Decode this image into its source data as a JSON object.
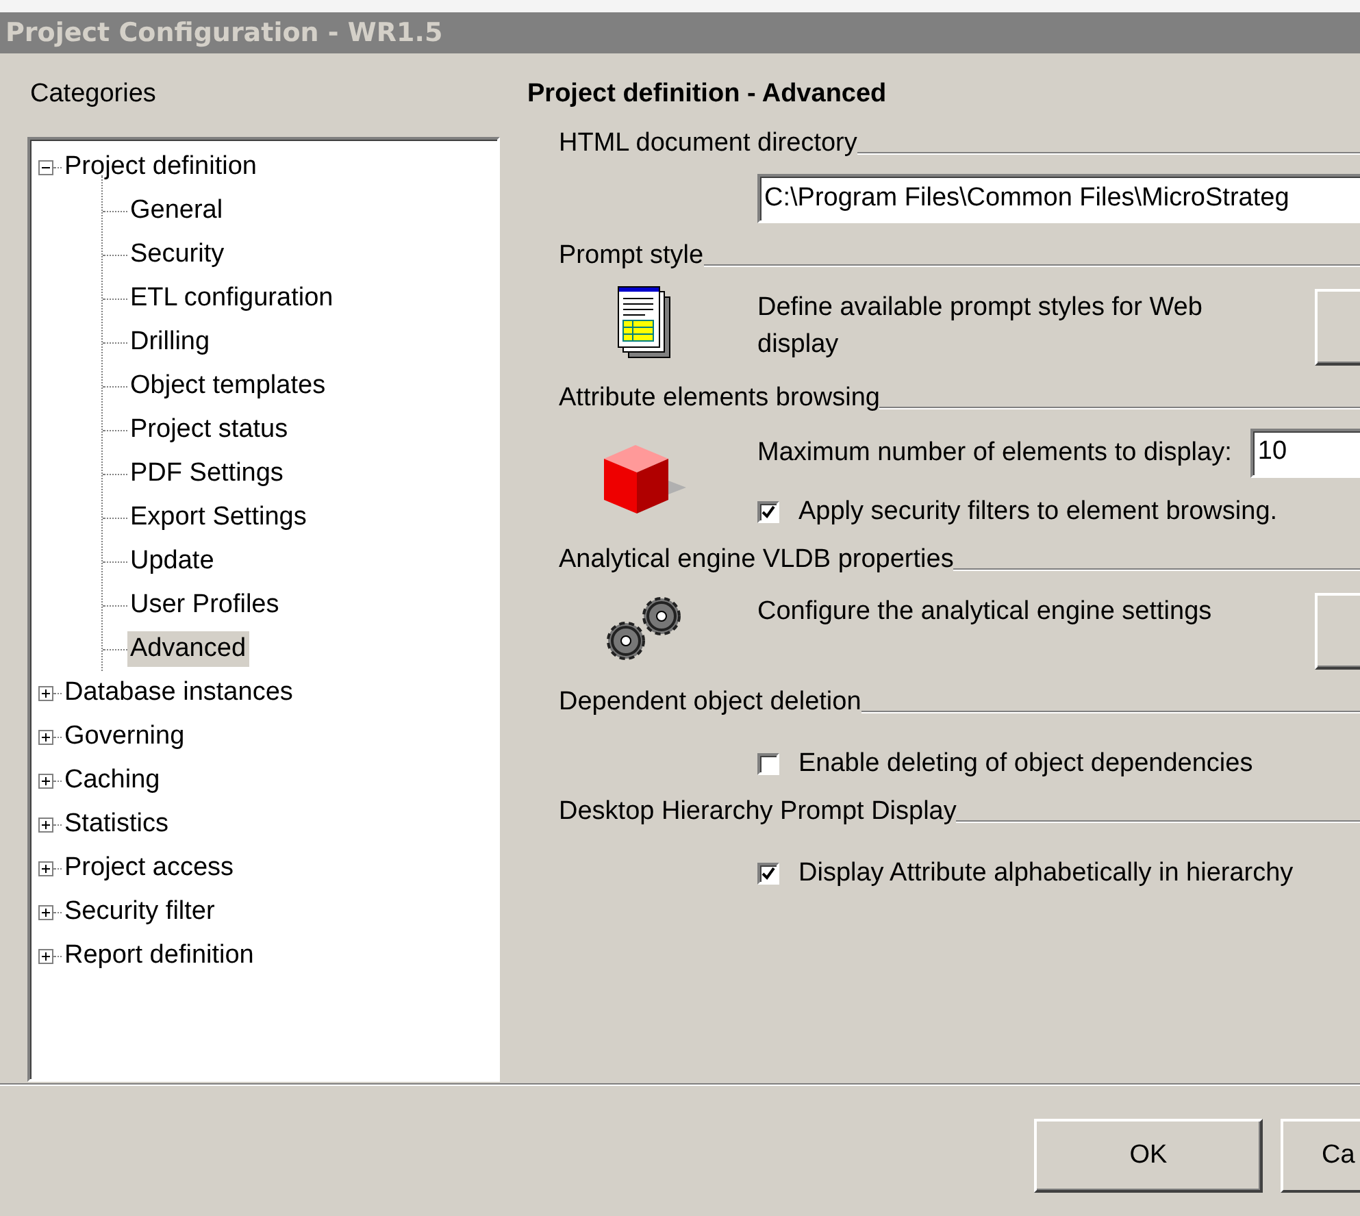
{
  "window": {
    "title": "Project Configuration - WR1.5"
  },
  "categories": {
    "label": "Categories",
    "items": [
      {
        "label": "Project definition",
        "expanded": true,
        "selected": false,
        "children": [
          {
            "label": "General",
            "selected": false
          },
          {
            "label": "Security",
            "selected": false
          },
          {
            "label": "ETL configuration",
            "selected": false
          },
          {
            "label": "Drilling",
            "selected": false
          },
          {
            "label": "Object templates",
            "selected": false
          },
          {
            "label": "Project status",
            "selected": false
          },
          {
            "label": "PDF Settings",
            "selected": false
          },
          {
            "label": "Export Settings",
            "selected": false
          },
          {
            "label": "Update",
            "selected": false
          },
          {
            "label": "User Profiles",
            "selected": false
          },
          {
            "label": "Advanced",
            "selected": true
          }
        ]
      },
      {
        "label": "Database instances",
        "expanded": false,
        "selected": false
      },
      {
        "label": "Governing",
        "expanded": false,
        "selected": false
      },
      {
        "label": "Caching",
        "expanded": false,
        "selected": false
      },
      {
        "label": "Statistics",
        "expanded": false,
        "selected": false
      },
      {
        "label": "Project access",
        "expanded": false,
        "selected": false
      },
      {
        "label": "Security filter",
        "expanded": false,
        "selected": false
      },
      {
        "label": "Report definition",
        "expanded": false,
        "selected": false
      }
    ]
  },
  "panel": {
    "heading": "Project definition - Advanced",
    "sections": [
      {
        "kind": "path",
        "title": "HTML document directory",
        "value": "C:\\Program Files\\Common Files\\MicroStrateg"
      },
      {
        "kind": "action",
        "title": "Prompt style",
        "text": "Define available prompt styles for Web display"
      },
      {
        "kind": "limit",
        "title": "Attribute elements browsing",
        "label": "Maximum number of elements to display:",
        "value": "10",
        "checkbox": {
          "label": "Apply security filters to element browsing.",
          "checked": true
        }
      },
      {
        "kind": "action",
        "title": "Analytical engine VLDB properties",
        "text": "Configure the analytical engine settings"
      },
      {
        "kind": "checkbox",
        "title": "Dependent object deletion",
        "checkbox": {
          "label": "Enable deleting of object dependencies",
          "checked": false
        }
      },
      {
        "kind": "checkbox",
        "title": "Desktop Hierarchy Prompt Display",
        "checkbox": {
          "label": "Display Attribute alphabetically in hierarchy",
          "checked": true
        }
      }
    ]
  },
  "buttons": [
    "OK",
    "Ca"
  ]
}
